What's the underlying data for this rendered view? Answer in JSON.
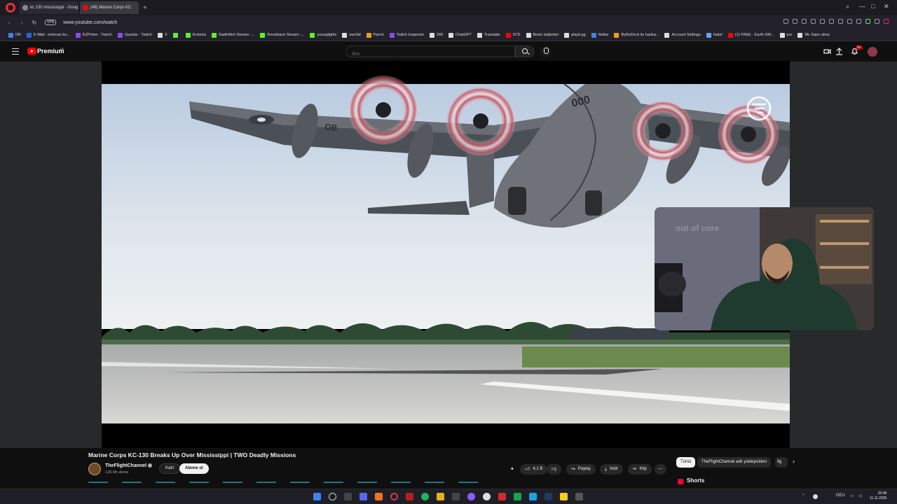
{
  "browser": {
    "tabs": [
      {
        "label": "kc 130 mississippi - Goog",
        "favicon_color": "#888888"
      },
      {
        "label": "(46) Marine Corps KC",
        "favicon_color": "#ff0000"
      }
    ],
    "url": "www.youtube.com/watch",
    "vpn_label": "VPN",
    "bookmarks": [
      {
        "label": "DR",
        "color": "#3b82f6"
      },
      {
        "label": "E-Mail - emircan ko...",
        "color": "#2563eb"
      },
      {
        "label": "KZPrime - Twitch",
        "color": "#9146ff"
      },
      {
        "label": "Uyanlar - Twitch",
        "color": "#9146ff"
      },
      {
        "label": "X",
        "color": "#dddddd"
      },
      {
        "label": "",
        "color": "#53fc18"
      },
      {
        "label": "Krolexis",
        "color": "#53fc18"
      },
      {
        "label": "KadirMert Stream -...",
        "color": "#53fc18"
      },
      {
        "label": "Roxobians Stream -...",
        "color": "#53fc18"
      },
      {
        "label": "younglightx",
        "color": "#53fc18"
      },
      {
        "label": "own3d",
        "color": "#dddddd"
      },
      {
        "label": "Parrot",
        "color": "#f59e0b"
      },
      {
        "label": "Twitch Inspector",
        "color": "#9146ff"
      },
      {
        "label": "DM",
        "color": "#dddddd"
      },
      {
        "label": "ChatGPT",
        "color": "#dddddd"
      },
      {
        "label": "Translate",
        "color": "#dddddd"
      },
      {
        "label": "STD",
        "color": "#ff0000"
      },
      {
        "label": "Besin değerleri",
        "color": "#dddddd"
      },
      {
        "label": "playit.gg",
        "color": "#dddddd"
      },
      {
        "label": "Notlar",
        "color": "#3b82f6"
      },
      {
        "label": "ByNoDeck ile harika...",
        "color": "#f59e0b"
      },
      {
        "label": "Account Settings",
        "color": "#dddddd"
      },
      {
        "label": "Hata!",
        "color": "#60a5fa"
      },
      {
        "label": "(1) FREE - Earth-SM...",
        "color": "#ff0000"
      },
      {
        "label": "pro",
        "color": "#dddddd"
      },
      {
        "label": "Mc Satın alma",
        "color": "#dddddd"
      }
    ]
  },
  "youtube": {
    "brand": "Premium",
    "region": "DE",
    "search_placeholder": "Ara",
    "notification_count": "9+",
    "video": {
      "title": "Marine Corps KC-130 Breaks Up Over Mississippi | TWO Deadly Missions",
      "channel": "TheFlightChannel",
      "subscribers": "1,81 Mn abone",
      "join_label": "Katıl",
      "subscribe_label": "Abone ol",
      "likes": "4,1 B",
      "share_label": "Paylaş",
      "download_label": "İndir",
      "clip_label": "Klip",
      "aircraft_marking": "000",
      "wing_marking": "OB"
    },
    "chips": [
      {
        "label": "Tümü",
        "selected": true
      },
      {
        "label": "TheFlightChannel adlı yükleyiciden",
        "selected": false
      },
      {
        "label": "İlg",
        "selected": false
      }
    ],
    "shorts_label": "Shorts",
    "webcam_text": "out of core"
  },
  "taskbar": {
    "language": "DEU",
    "time": "20:48",
    "date": "11.11.2025"
  }
}
